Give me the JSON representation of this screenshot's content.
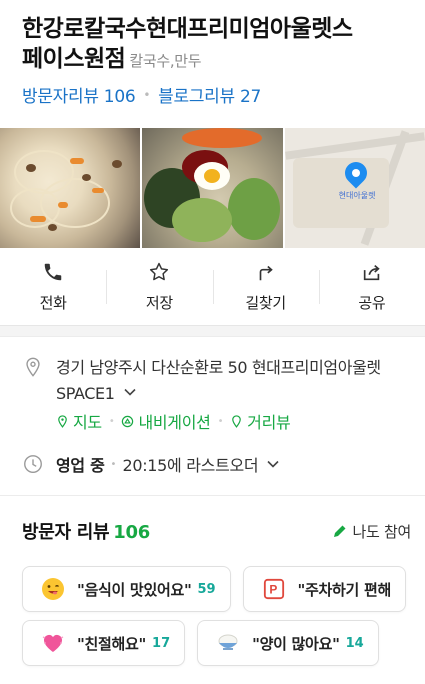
{
  "header": {
    "title_line1": "한강로칼국수현대프리미엄아울렛스",
    "title_line2": "페이스원점",
    "category": "칼국수,만두",
    "visitor_reviews": "방문자리뷰 106",
    "blog_reviews": "블로그리뷰 27"
  },
  "photos": {
    "map_label": "현대아울렛"
  },
  "actions": [
    {
      "label": "전화",
      "icon": "phone-icon"
    },
    {
      "label": "저장",
      "icon": "star-icon"
    },
    {
      "label": "길찾기",
      "icon": "directions-icon"
    },
    {
      "label": "공유",
      "icon": "share-icon"
    }
  ],
  "info": {
    "address": "경기 남양주시 다산순환로 50 현대프리미엄아울렛 SPACE1",
    "links": [
      "지도",
      "내비게이션",
      "거리뷰"
    ],
    "hours_status": "영업 중",
    "hours_text": "20:15에 라스트오더"
  },
  "reviews": {
    "title": "방문자 리뷰",
    "count": "106",
    "write_label": "나도 참여",
    "chips": [
      {
        "text": "\"음식이 맛있어요\"",
        "count": "59",
        "icon": "yum-face-icon"
      },
      {
        "text": "\"주차하기 편해",
        "count": "",
        "icon": "parking-icon"
      },
      {
        "text": "\"친절해요\"",
        "count": "17",
        "icon": "heart-icon"
      },
      {
        "text": "\"양이 많아요\"",
        "count": "14",
        "icon": "rice-bowl-icon"
      }
    ]
  },
  "colors": {
    "link_blue": "#1a73c7",
    "accent_green": "#17a843",
    "count_teal": "#17a89a"
  }
}
